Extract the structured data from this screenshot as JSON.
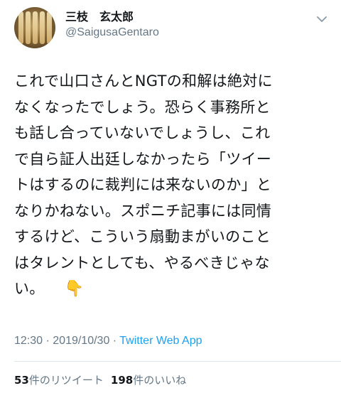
{
  "author": {
    "display_name": "三枝　玄太郎",
    "handle": "@SaigusaGentaro"
  },
  "tweet": {
    "lines": [
      "これで山口さんとNGTの和解は絶対に",
      "なくなったでしょう。恐らく事務所と",
      "も話し合っていないでしょうし、これ",
      "で自ら証人出廷しなかったら「ツイー",
      "トはするのに裁判には来ないのか」と",
      "なりかねない。スポニチ記事には同情",
      "するけど、こういう扇動まがいのこと",
      "はタレントとしても、やるべきじゃな",
      "い。"
    ],
    "emoji": "👇"
  },
  "meta": {
    "time": "12:30",
    "separator": " · ",
    "date": "2019/10/30",
    "source": "Twitter Web App"
  },
  "stats": {
    "retweets_count": "53",
    "retweets_label": "件のリツイート",
    "likes_count": "198",
    "likes_label": "件のいいね"
  },
  "icons": {
    "more": "chevron-down-icon",
    "hand": "backhand-pointing-down-emoji"
  },
  "colors": {
    "text": "#14171a",
    "secondary": "#657786",
    "link": "#1da1f2",
    "divider": "#e1e8ed"
  }
}
